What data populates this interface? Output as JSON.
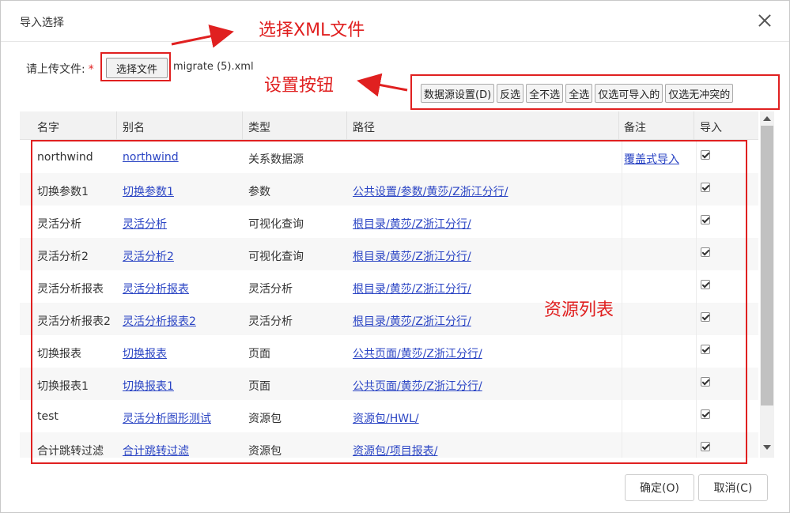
{
  "dialog": {
    "title": "导入选择"
  },
  "upload": {
    "label": "请上传文件:",
    "required_mark": "*",
    "choose_button": "选择文件",
    "file_name": "migrate (5).xml"
  },
  "toolbar": {
    "buttons": [
      "数据源设置(D)",
      "反选",
      "全不选",
      "全选",
      "仅选可导入的",
      "仅选无冲突的"
    ]
  },
  "annotations": {
    "select_xml": "选择XML文件",
    "settings_buttons": "设置按钮",
    "resource_list": "资源列表",
    "accent_color": "#e02020"
  },
  "table": {
    "headers": [
      "名字",
      "别名",
      "类型",
      "路径",
      "备注",
      "导入"
    ],
    "rows": [
      {
        "name": "northwind",
        "alias": "northwind",
        "type": "关系数据源",
        "path": "",
        "note": "覆盖式导入",
        "checked": true
      },
      {
        "name": "切换参数1",
        "alias": "切换参数1",
        "type": "参数",
        "path": "公共设置/参数/黄莎/Z浙江分行/",
        "note": "",
        "checked": true
      },
      {
        "name": "灵活分析",
        "alias": "灵活分析",
        "type": "可视化查询",
        "path": "根目录/黄莎/Z浙江分行/",
        "note": "",
        "checked": true
      },
      {
        "name": "灵活分析2",
        "alias": "灵活分析2",
        "type": "可视化查询",
        "path": "根目录/黄莎/Z浙江分行/",
        "note": "",
        "checked": true
      },
      {
        "name": "灵活分析报表",
        "alias": "灵活分析报表",
        "type": "灵活分析",
        "path": "根目录/黄莎/Z浙江分行/",
        "note": "",
        "checked": true
      },
      {
        "name": "灵活分析报表2",
        "alias": "灵活分析报表2",
        "type": "灵活分析",
        "path": "根目录/黄莎/Z浙江分行/",
        "note": "",
        "checked": true
      },
      {
        "name": "切换报表",
        "alias": "切换报表",
        "type": "页面",
        "path": "公共页面/黄莎/Z浙江分行/",
        "note": "",
        "checked": true
      },
      {
        "name": "切换报表1",
        "alias": "切换报表1",
        "type": "页面",
        "path": "公共页面/黄莎/Z浙江分行/",
        "note": "",
        "checked": true
      },
      {
        "name": "test",
        "alias": "灵活分析图形测试",
        "type": "资源包",
        "path": "资源包/HWL/",
        "note": "",
        "checked": true
      },
      {
        "name": "合计跳转过滤",
        "alias": "合计跳转过滤",
        "type": "资源包",
        "path": "资源包/项目报表/",
        "note": "",
        "checked": true
      }
    ]
  },
  "footer": {
    "ok": "确定(O)",
    "cancel": "取消(C)"
  }
}
